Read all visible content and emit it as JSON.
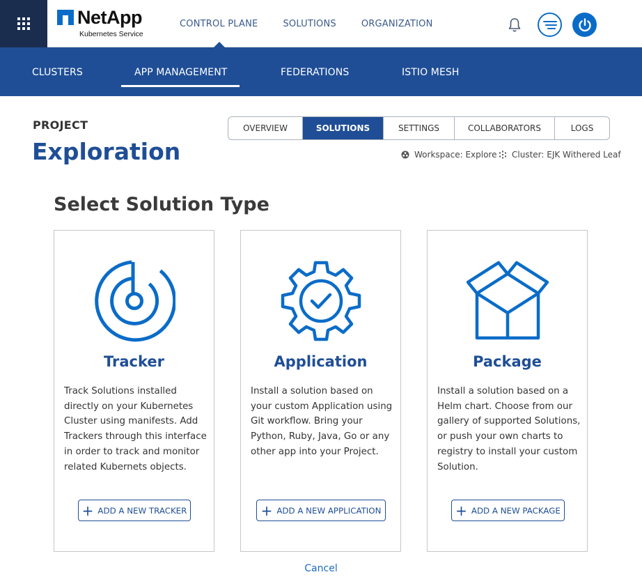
{
  "brand": {
    "name": "NetApp",
    "subtitle": "Kubernetes Service"
  },
  "top_nav": [
    "CONTROL PLANE",
    "SOLUTIONS",
    "ORGANIZATION"
  ],
  "sub_nav": [
    "CLUSTERS",
    "APP MANAGEMENT",
    "FEDERATIONS",
    "ISTIO MESH"
  ],
  "sub_nav_active": "APP MANAGEMENT",
  "project": {
    "label": "PROJECT",
    "name": "Exploration"
  },
  "project_tabs": [
    "OVERVIEW",
    "SOLUTIONS",
    "SETTINGS",
    "COLLABORATORS",
    "LOGS"
  ],
  "project_tab_active": "SOLUTIONS",
  "meta": {
    "workspace": "Workspace: Explore",
    "cluster": "Cluster: EJK Withered Leaf"
  },
  "section_title": "Select Solution Type",
  "cards": [
    {
      "icon": "tracker-icon",
      "title": "Tracker",
      "description": "Track Solutions installed directly on your Kubernetes Cluster using manifests. Add Trackers through this interface in order to track and monitor related Kubernets objects.",
      "button": "ADD A NEW TRACKER"
    },
    {
      "icon": "gear-check-icon",
      "title": "Application",
      "description": "Install a solution based on your custom Application using Git workflow. Bring your Python, Ruby, Java, Go or any other app into your Project.",
      "button": "ADD A NEW APPLICATION"
    },
    {
      "icon": "package-box-icon",
      "title": "Package",
      "description": "Install a solution based on a Helm chart. Choose from our gallery of supported Solutions, or push your own charts to registry to install your custom Solution.",
      "button": "ADD A NEW PACKAGE"
    }
  ],
  "cancel_label": "Cancel",
  "colors": {
    "primary": "#1f4e96",
    "header_dark": "#1a2d4f",
    "accent_blue": "#0b6cc8"
  }
}
